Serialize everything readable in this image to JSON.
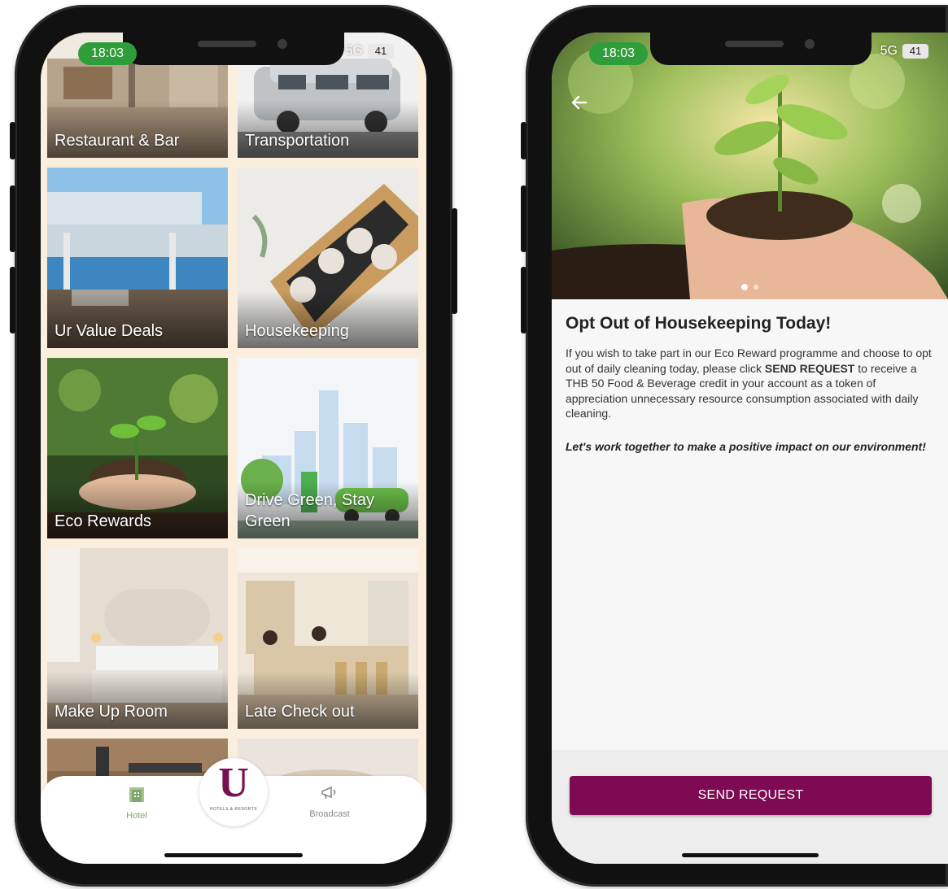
{
  "status_bar": {
    "time": "18:03",
    "network": "5G",
    "battery": "41"
  },
  "hotel_screen": {
    "tiles": [
      {
        "label": "Restaurant & Bar"
      },
      {
        "label": "Transportation"
      },
      {
        "label": "Ur Value Deals"
      },
      {
        "label": "Housekeeping"
      },
      {
        "label": "Eco Rewards"
      },
      {
        "label": "Drive Green, Stay Green"
      },
      {
        "label": "Make Up Room"
      },
      {
        "label": "Late Check out"
      },
      {
        "label": ""
      },
      {
        "label": ""
      }
    ],
    "bottom_nav": {
      "hotel_label": "Hotel",
      "broadcast_label": "Broadcast",
      "logo_letter": "U",
      "logo_text": "HOTELS & RESORTS"
    }
  },
  "detail_screen": {
    "title": "Opt Out of Housekeeping Today!",
    "body_part1": "If you wish to take part in our Eco Reward programme and choose to opt out of daily cleaning today, please click ",
    "body_bold": "SEND REQUEST",
    "body_part2": " to receive a THB 50 Food & Beverage credit in your account as a token of appreciation unnecessary resource consumption associated with daily cleaning.",
    "tagline": "Let's work together to make a positive impact on our environment!",
    "button_label": "SEND REQUEST",
    "carousel_pages": 2,
    "carousel_active": 1
  },
  "colors": {
    "brand": "#7d0a52",
    "tile_background": "#fbeedd",
    "status_pill": "#2e9e3a",
    "nav_active": "#7ea96a"
  },
  "icons": {
    "back": "arrow-left-icon",
    "hotel": "hotel-building-icon",
    "broadcast": "megaphone-icon"
  }
}
